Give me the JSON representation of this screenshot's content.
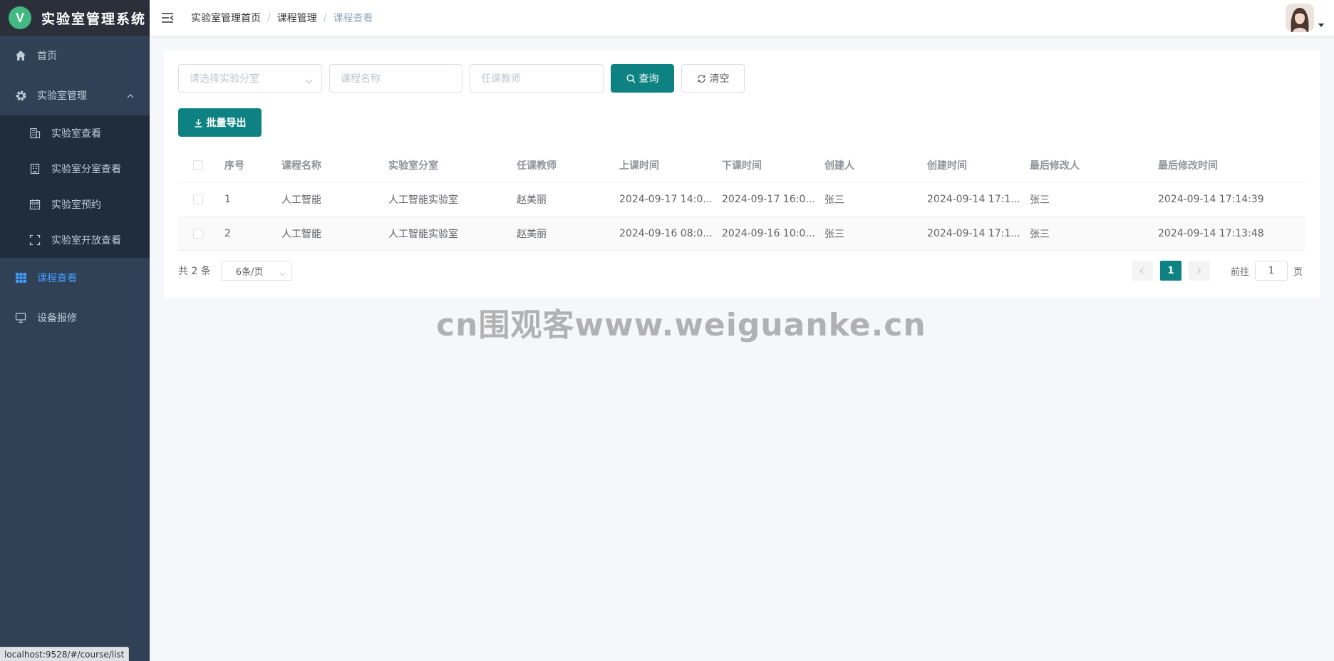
{
  "app": {
    "logo_letter": "V",
    "title": "实验室管理系统"
  },
  "sidebar": {
    "items": [
      {
        "label": "首页",
        "icon": "home-icon"
      },
      {
        "label": "实验室管理",
        "icon": "gear-icon",
        "expanded": true,
        "children": [
          {
            "label": "实验室查看",
            "icon": "building-icon"
          },
          {
            "label": "实验室分室查看",
            "icon": "office-icon"
          },
          {
            "label": "实验室预约",
            "icon": "calendar-icon"
          },
          {
            "label": "实验室开放查看",
            "icon": "fullscreen-icon"
          }
        ]
      },
      {
        "label": "课程查看",
        "icon": "grid-icon",
        "active": true
      },
      {
        "label": "设备报修",
        "icon": "monitor-icon"
      }
    ]
  },
  "header": {
    "breadcrumb": [
      "实验室管理首页",
      "课程管理",
      "课程查看"
    ]
  },
  "filters": {
    "branch_placeholder": "请选择实验分室",
    "course_placeholder": "课程名称",
    "teacher_placeholder": "任课教师",
    "search_label": "查询",
    "clear_label": "清空"
  },
  "toolbar": {
    "export_label": "批量导出"
  },
  "table": {
    "headers": [
      "序号",
      "课程名称",
      "实验室分室",
      "任课教师",
      "上课时间",
      "下课时间",
      "创建人",
      "创建时间",
      "最后修改人",
      "最后修改时间"
    ],
    "rows": [
      [
        "1",
        "人工智能",
        "人工智能实验室",
        "赵美丽",
        "2024-09-17 14:0...",
        "2024-09-17 16:0...",
        "张三",
        "2024-09-14 17:1...",
        "张三",
        "2024-09-14 17:14:39"
      ],
      [
        "2",
        "人工智能",
        "人工智能实验室",
        "赵美丽",
        "2024-09-16 08:0...",
        "2024-09-16 10:0...",
        "张三",
        "2024-09-14 17:1...",
        "张三",
        "2024-09-14 17:13:48"
      ]
    ]
  },
  "pagination": {
    "total": "共 2 条",
    "page_size": "6条/页",
    "current_page": "1",
    "goto_prefix": "前往",
    "goto_value": "1",
    "goto_suffix": "页"
  },
  "watermark": "cn围观客www.weiguanke.cn",
  "statusbar": "localhost:9528/#/course/list",
  "colors": {
    "primary": "#0e8282",
    "sidebar_bg": "#304156",
    "active_menu": "#409eff"
  }
}
